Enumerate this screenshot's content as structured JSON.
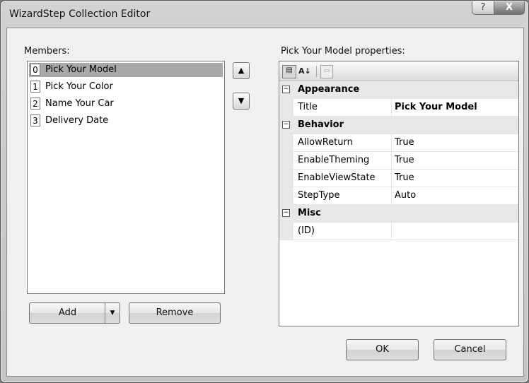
{
  "window": {
    "title": "WizardStep Collection Editor",
    "help_glyph": "?",
    "close_glyph": "X"
  },
  "members": {
    "label": "Members:",
    "items": [
      {
        "index": "0",
        "name": "Pick Your Model",
        "selected": true
      },
      {
        "index": "1",
        "name": "Pick Your Color",
        "selected": false
      },
      {
        "index": "2",
        "name": "Name Your Car",
        "selected": false
      },
      {
        "index": "3",
        "name": "Delivery Date",
        "selected": false
      }
    ],
    "move_up_glyph": "▲",
    "move_down_glyph": "▼",
    "add_label": "Add",
    "add_dropdown_glyph": "▼",
    "remove_label": "Remove"
  },
  "properties": {
    "label": "Pick Your Model properties:",
    "toolbar": {
      "categorized_icon": "categorized-icon",
      "alphabetical_icon": "alphabetical-sort-icon",
      "alphabetical_glyph": "A↓",
      "property_pages_icon": "property-pages-icon"
    },
    "categories": [
      {
        "name": "Appearance",
        "toggle": "⊟",
        "props": [
          {
            "name": "Title",
            "value": "Pick Your Model",
            "bold": true
          }
        ]
      },
      {
        "name": "Behavior",
        "toggle": "⊟",
        "props": [
          {
            "name": "AllowReturn",
            "value": "True",
            "bold": false
          },
          {
            "name": "EnableTheming",
            "value": "True",
            "bold": false
          },
          {
            "name": "EnableViewState",
            "value": "True",
            "bold": false
          },
          {
            "name": "StepType",
            "value": "Auto",
            "bold": false
          }
        ]
      },
      {
        "name": "Misc",
        "toggle": "⊟",
        "props": [
          {
            "name": "(ID)",
            "value": "",
            "bold": false
          }
        ]
      }
    ]
  },
  "footer": {
    "ok_label": "OK",
    "cancel_label": "Cancel"
  },
  "colors": {
    "selection": "#a8a8a8",
    "dialog_bg": "#f0f0f0",
    "category_bg": "#e8e8e8"
  }
}
